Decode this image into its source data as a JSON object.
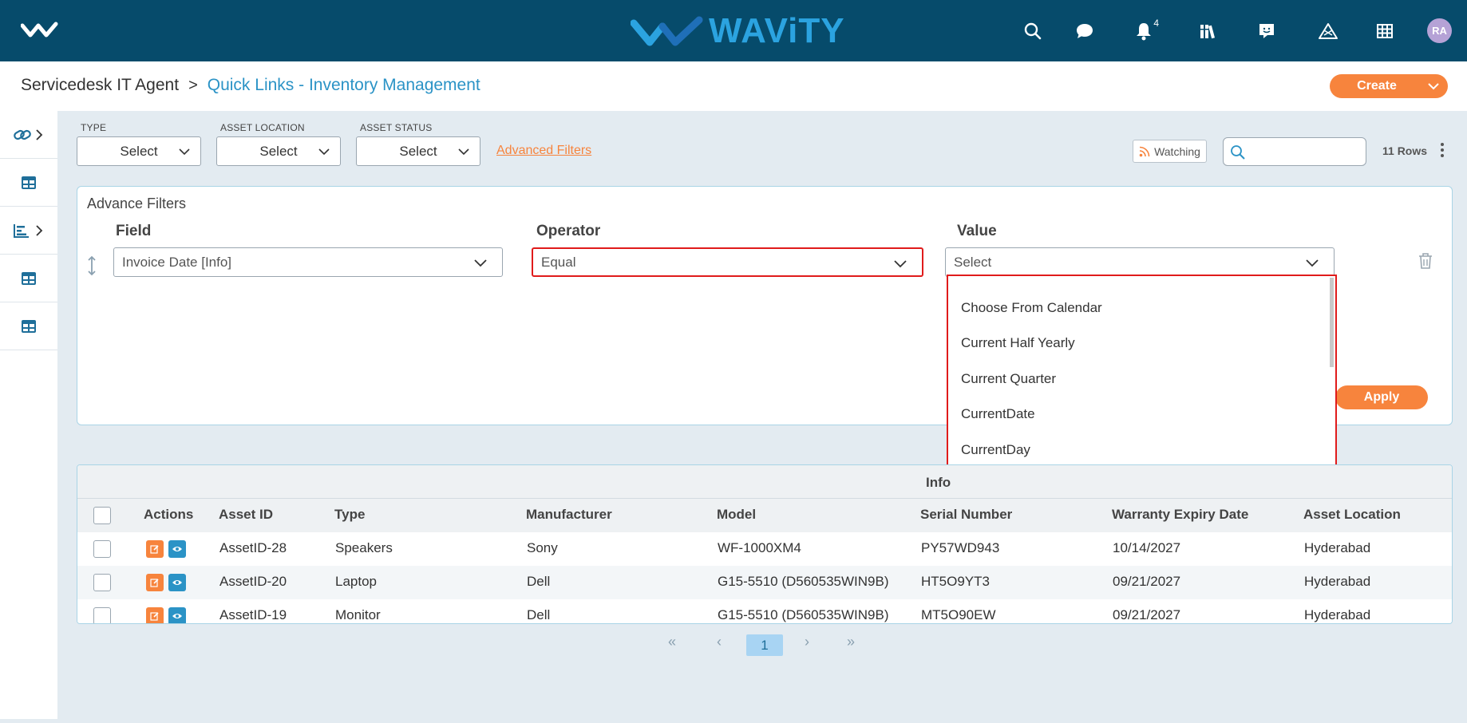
{
  "topbar": {
    "brand": "WAViTY",
    "notification_count": "4",
    "avatar_initials": "RA",
    "icons": [
      "search-icon",
      "chat-icon",
      "bell-icon",
      "library-icon",
      "feedback-icon",
      "alert-icon",
      "grid-icon"
    ]
  },
  "breadcrumb": {
    "parent": "Servicedesk IT Agent",
    "separator": ">",
    "current": "Quick Links - Inventory Management"
  },
  "create_button": "Create",
  "filters": {
    "type": {
      "label": "TYPE",
      "value": "Select"
    },
    "location": {
      "label": "ASSET LOCATION",
      "value": "Select"
    },
    "status": {
      "label": "ASSET STATUS",
      "value": "Select"
    },
    "advanced_link": "Advanced Filters"
  },
  "toolbar": {
    "watching": "Watching",
    "search_value": "",
    "rows": "11 Rows"
  },
  "advance_filters": {
    "title": "Advance Filters",
    "field_header": "Field",
    "operator_header": "Operator",
    "value_header": "Value",
    "field_value": "Invoice Date [Info]",
    "operator_value": "Equal",
    "value_value": "Select",
    "apply": "Apply",
    "value_options": [
      "Choose From Calendar",
      "Current Half Yearly",
      "Current Quarter",
      "CurrentDate",
      "CurrentDay"
    ]
  },
  "table": {
    "group_header": "Info",
    "columns": [
      "Actions",
      "Asset ID",
      "Type",
      "Manufacturer",
      "Model",
      "Serial Number",
      "Warranty Expiry Date",
      "Asset Location"
    ],
    "rows": [
      {
        "id": "AssetID-28",
        "type": "Speakers",
        "manufacturer": "Sony",
        "model": "WF-1000XM4",
        "serial": "PY57WD943",
        "warranty": "10/14/2027",
        "location": "Hyderabad"
      },
      {
        "id": "AssetID-20",
        "type": "Laptop",
        "manufacturer": "Dell",
        "model": "G15-5510 (D560535WIN9B)",
        "serial": "HT5O9YT3",
        "warranty": "09/21/2027",
        "location": "Hyderabad"
      },
      {
        "id": "AssetID-19",
        "type": "Monitor",
        "manufacturer": "Dell",
        "model": "G15-5510 (D560535WIN9B)",
        "serial": "MT5O90EW",
        "warranty": "09/21/2027",
        "location": "Hyderabad"
      }
    ]
  },
  "pagination": {
    "first": "«",
    "prev": "‹",
    "current": "1",
    "next": "›",
    "last": "»"
  },
  "colors": {
    "topbar": "#064b6b",
    "accent_orange": "#f7843d",
    "link_blue": "#2b93c6",
    "highlight_red": "#e01b1b"
  }
}
